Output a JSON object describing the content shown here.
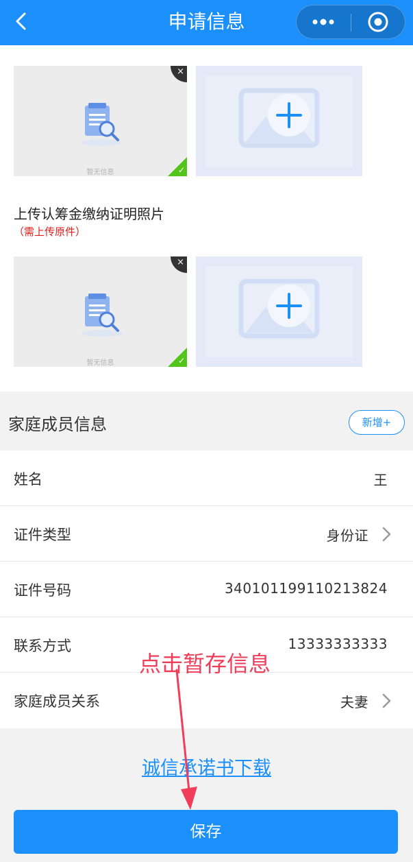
{
  "nav": {
    "title": "申请信息",
    "back_icon": "back-arrow-icon",
    "more_icon": "more-dots-icon",
    "close_icon": "target-circle-icon"
  },
  "uploads": [
    {
      "thumbnail_caption": "暂无信息",
      "delete_symbol": "×",
      "check_symbol": "✓"
    },
    {
      "thumbnail_caption": "暂无信息",
      "delete_symbol": "×",
      "check_symbol": "✓"
    }
  ],
  "upload_section": {
    "label": "上传认筹金缴纳证明照片",
    "hint": "（需上传原件）"
  },
  "family_section": {
    "title": "家庭成员信息",
    "add_button": "新增+"
  },
  "form": {
    "rows": [
      {
        "label": "姓名",
        "value": "王"
      },
      {
        "label": "证件类型",
        "value": "身份证"
      },
      {
        "label": "证件号码",
        "value": "340101199110213824"
      },
      {
        "label": "联系方式",
        "value": "13333333333"
      },
      {
        "label": "家庭成员关系",
        "value": "夫妻"
      }
    ]
  },
  "download_link": "诚信承诺书下载",
  "save_button": "保存",
  "annotation": {
    "text": "点击暂存信息",
    "color": "#f03d5a"
  },
  "colors": {
    "primary": "#1b90fa",
    "success": "#52c41a",
    "hint_red": "#e11d1d"
  }
}
